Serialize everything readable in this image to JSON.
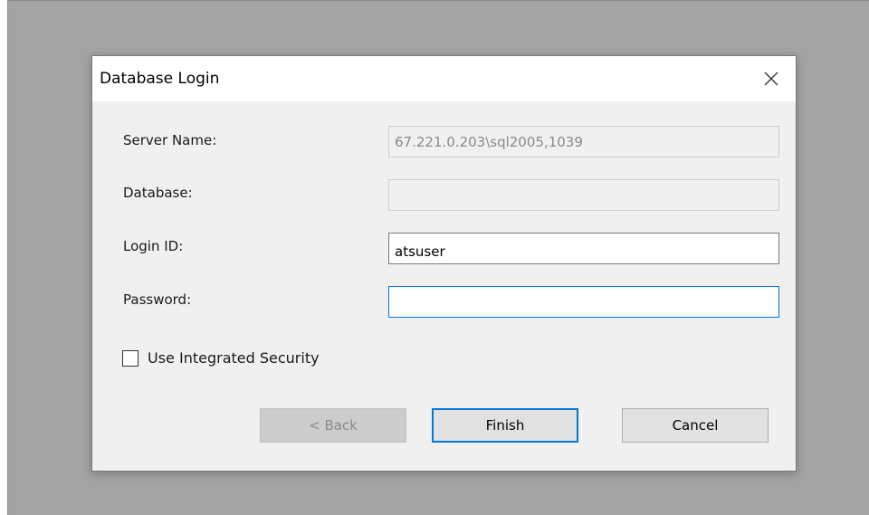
{
  "dialog": {
    "title": "Database Login"
  },
  "form": {
    "server_name_label": "Server Name:",
    "server_name_value": "67.221.0.203\\sql2005,1039",
    "database_label": "Database:",
    "database_value": "",
    "login_id_label": "Login ID:",
    "login_id_value": "atsuser",
    "password_label": "Password:",
    "password_value": "",
    "integrated_security_label": "Use Integrated Security",
    "integrated_security_checked": false
  },
  "buttons": {
    "back_label": "< Back",
    "finish_label": "Finish",
    "cancel_label": "Cancel"
  },
  "colors": {
    "accent": "#0078d7",
    "background": "#a4a4a4",
    "dialog_body": "#f0f0f0"
  },
  "icons": {
    "close": "close-icon"
  }
}
